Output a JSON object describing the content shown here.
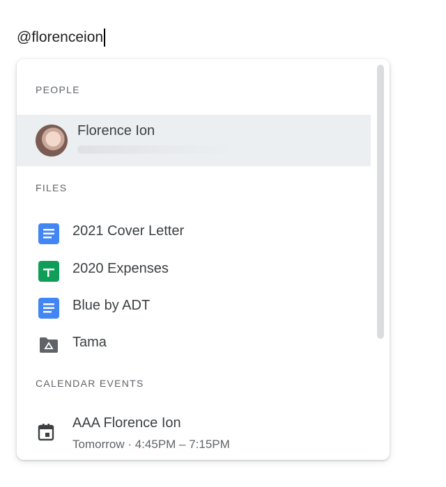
{
  "input": {
    "text": "@florenceion"
  },
  "popup": {
    "people_header": "PEOPLE",
    "people": [
      {
        "name": "Florence Ion",
        "email_redacted": true
      }
    ],
    "files_header": "FILES",
    "files": [
      {
        "label": "2021 Cover Letter",
        "icon": "docs-icon",
        "color": "#4285f4"
      },
      {
        "label": "2020 Expenses",
        "icon": "sheets-icon",
        "color": "#0f9d58"
      },
      {
        "label": "Blue by ADT",
        "icon": "docs-icon",
        "color": "#4285f4"
      },
      {
        "label": "Tama",
        "icon": "shared-drive-folder-icon",
        "color": "#5f6368"
      }
    ],
    "calendar_header": "CALENDAR EVENTS",
    "events": [
      {
        "title": "AAA Florence Ion",
        "time": "Tomorrow · 4:45PM – 7:15PM",
        "icon": "calendar-icon"
      }
    ]
  },
  "colors": {
    "highlight_row": "#eceff1",
    "scrollbar": "#dadce0"
  }
}
